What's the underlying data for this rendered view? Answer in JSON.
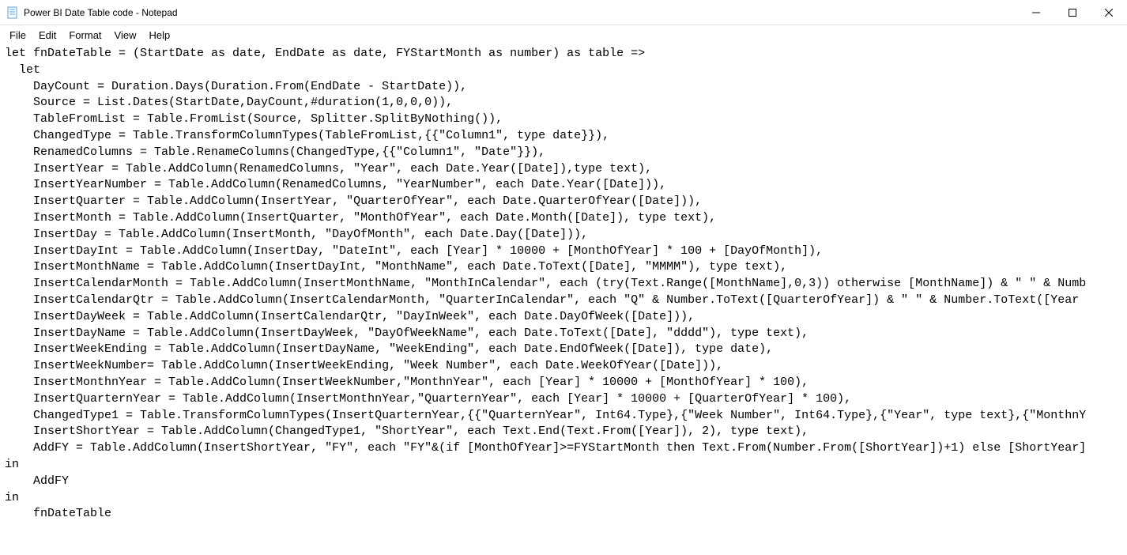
{
  "window": {
    "title": "Power BI Date Table code - Notepad"
  },
  "menu": {
    "items": [
      "File",
      "Edit",
      "Format",
      "View",
      "Help"
    ]
  },
  "editor": {
    "content": "let fnDateTable = (StartDate as date, EndDate as date, FYStartMonth as number) as table =>\n  let\n    DayCount = Duration.Days(Duration.From(EndDate - StartDate)),\n    Source = List.Dates(StartDate,DayCount,#duration(1,0,0,0)),\n    TableFromList = Table.FromList(Source, Splitter.SplitByNothing()),\n    ChangedType = Table.TransformColumnTypes(TableFromList,{{\"Column1\", type date}}),\n    RenamedColumns = Table.RenameColumns(ChangedType,{{\"Column1\", \"Date\"}}),\n    InsertYear = Table.AddColumn(RenamedColumns, \"Year\", each Date.Year([Date]),type text),\n    InsertYearNumber = Table.AddColumn(RenamedColumns, \"YearNumber\", each Date.Year([Date])),\n    InsertQuarter = Table.AddColumn(InsertYear, \"QuarterOfYear\", each Date.QuarterOfYear([Date])),\n    InsertMonth = Table.AddColumn(InsertQuarter, \"MonthOfYear\", each Date.Month([Date]), type text),\n    InsertDay = Table.AddColumn(InsertMonth, \"DayOfMonth\", each Date.Day([Date])),\n    InsertDayInt = Table.AddColumn(InsertDay, \"DateInt\", each [Year] * 10000 + [MonthOfYear] * 100 + [DayOfMonth]),\n    InsertMonthName = Table.AddColumn(InsertDayInt, \"MonthName\", each Date.ToText([Date], \"MMMM\"), type text),\n    InsertCalendarMonth = Table.AddColumn(InsertMonthName, \"MonthInCalendar\", each (try(Text.Range([MonthName],0,3)) otherwise [MonthName]) & \" \" & Numb\n    InsertCalendarQtr = Table.AddColumn(InsertCalendarMonth, \"QuarterInCalendar\", each \"Q\" & Number.ToText([QuarterOfYear]) & \" \" & Number.ToText([Year\n    InsertDayWeek = Table.AddColumn(InsertCalendarQtr, \"DayInWeek\", each Date.DayOfWeek([Date])),\n    InsertDayName = Table.AddColumn(InsertDayWeek, \"DayOfWeekName\", each Date.ToText([Date], \"dddd\"), type text),\n    InsertWeekEnding = Table.AddColumn(InsertDayName, \"WeekEnding\", each Date.EndOfWeek([Date]), type date),\n    InsertWeekNumber= Table.AddColumn(InsertWeekEnding, \"Week Number\", each Date.WeekOfYear([Date])),\n    InsertMonthnYear = Table.AddColumn(InsertWeekNumber,\"MonthnYear\", each [Year] * 10000 + [MonthOfYear] * 100),\n    InsertQuarternYear = Table.AddColumn(InsertMonthnYear,\"QuarternYear\", each [Year] * 10000 + [QuarterOfYear] * 100),\n    ChangedType1 = Table.TransformColumnTypes(InsertQuarternYear,{{\"QuarternYear\", Int64.Type},{\"Week Number\", Int64.Type},{\"Year\", type text},{\"MonthnY\n    InsertShortYear = Table.AddColumn(ChangedType1, \"ShortYear\", each Text.End(Text.From([Year]), 2), type text),\n    AddFY = Table.AddColumn(InsertShortYear, \"FY\", each \"FY\"&(if [MonthOfYear]>=FYStartMonth then Text.From(Number.From([ShortYear])+1) else [ShortYear]\nin\n    AddFY\nin\n    fnDateTable"
  }
}
